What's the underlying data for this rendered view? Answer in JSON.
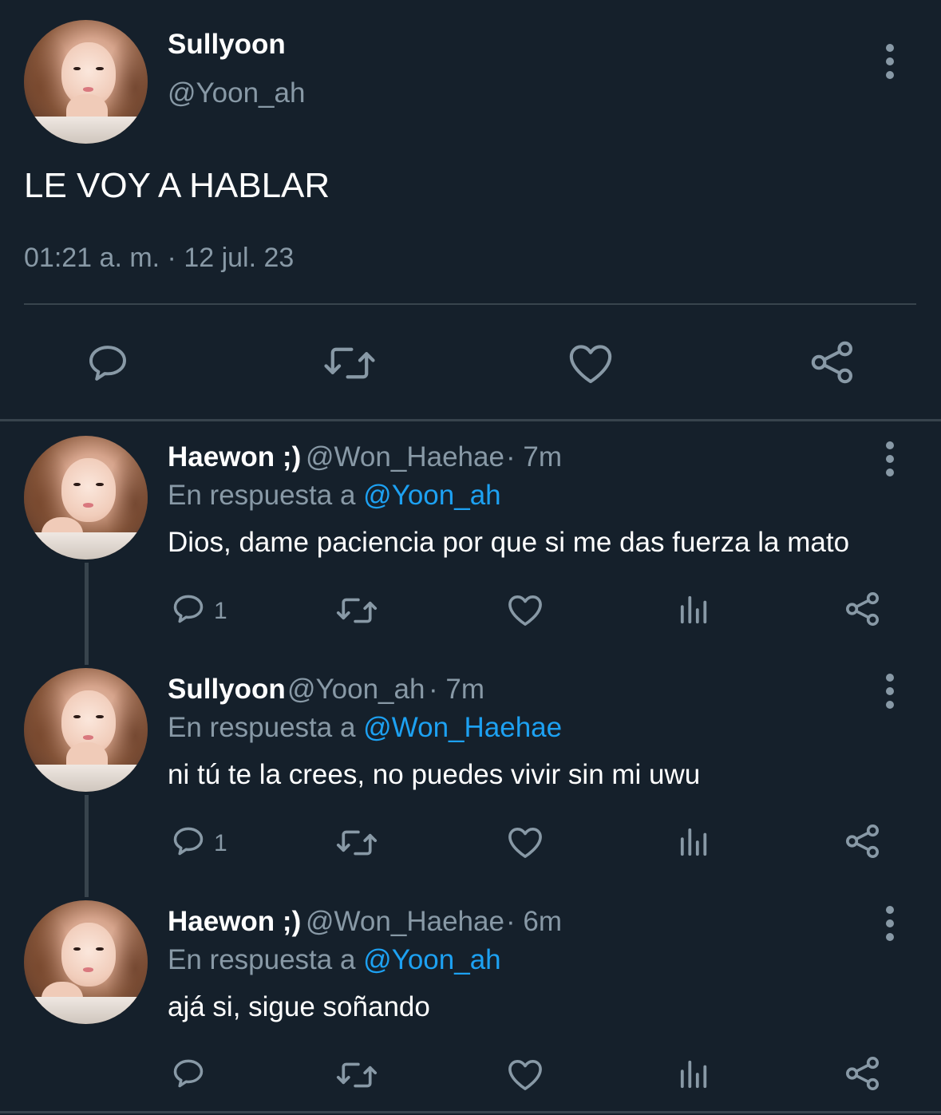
{
  "main_tweet": {
    "display_name": "Sullyoon",
    "handle": "@Yoon_ah",
    "text": "LE VOY A HABLAR",
    "timestamp": "01:21 a. m. · 12 jul. 23"
  },
  "replies": [
    {
      "display_name": "Haewon ;)",
      "handle": "@Won_Haehae",
      "time": "· 7m",
      "reply_prefix": "En respuesta a",
      "reply_to": "@Yoon_ah",
      "text": "Dios, dame paciencia por que si me das fuerza la mato",
      "reply_count": "1"
    },
    {
      "display_name": "Sullyoon",
      "handle": "@Yoon_ah",
      "time": "· 7m",
      "reply_prefix": "En respuesta a",
      "reply_to": "@Won_Haehae",
      "text": "ni tú te la crees, no puedes vivir sin mi uwu",
      "reply_count": "1"
    },
    {
      "display_name": "Haewon ;)",
      "handle": "@Won_Haehae",
      "time": "· 6m",
      "reply_prefix": "En respuesta a",
      "reply_to": "@Yoon_ah",
      "text": "ajá si, sigue soñando",
      "reply_count": ""
    }
  ],
  "icons": {
    "more": "more-vertical-icon",
    "reply": "reply-icon",
    "retweet": "retweet-icon",
    "like": "heart-icon",
    "analytics": "analytics-icon",
    "share": "share-icon"
  },
  "colors": {
    "background": "#15202b",
    "text": "#ffffff",
    "secondary": "#8899a6",
    "link": "#1da1f2",
    "divider": "#38444d"
  }
}
